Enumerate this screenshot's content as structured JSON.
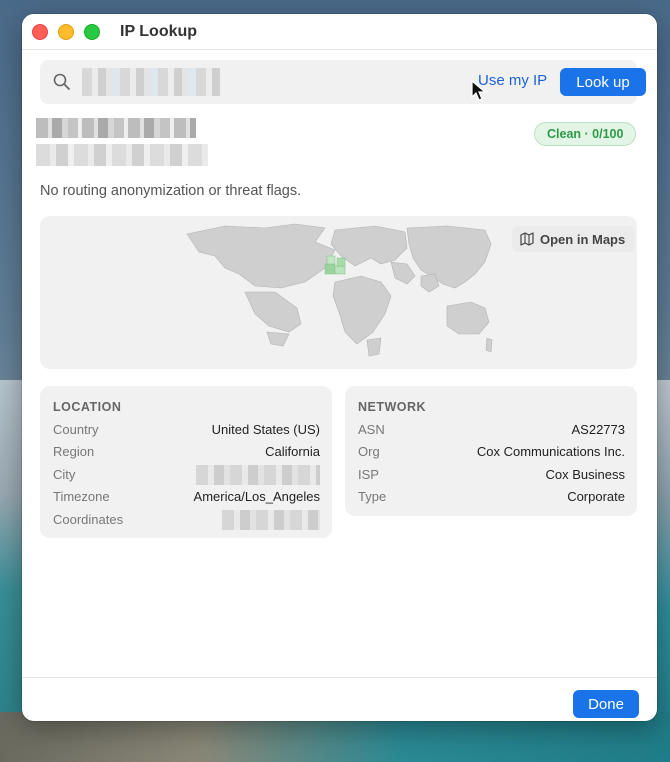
{
  "window": {
    "title": "IP Lookup"
  },
  "search": {
    "use_my_ip_label": "Use my IP",
    "lookup_label": "Look up"
  },
  "result": {
    "badge": "Clean · 0/100",
    "flags_text": "No routing anonymization or threat flags.",
    "open_maps_label": "Open in Maps"
  },
  "location": {
    "heading": "LOCATION",
    "rows": [
      {
        "key": "Country",
        "value": "United States (US)"
      },
      {
        "key": "Region",
        "value": "California"
      },
      {
        "key": "City",
        "value": ""
      },
      {
        "key": "Timezone",
        "value": "America/Los_Angeles"
      },
      {
        "key": "Coordinates",
        "value": ""
      }
    ]
  },
  "network": {
    "heading": "NETWORK",
    "rows": [
      {
        "key": "ASN",
        "value": "AS22773"
      },
      {
        "key": "Org",
        "value": "Cox Communications Inc."
      },
      {
        "key": "ISP",
        "value": "Cox Business"
      },
      {
        "key": "Type",
        "value": "Corporate"
      }
    ]
  },
  "footer": {
    "done_label": "Done"
  },
  "colors": {
    "accent": "#1a73e8",
    "clean_badge_text": "#2e9a48",
    "clean_badge_bg": "#e3f5e6"
  },
  "icons": [
    "search-icon",
    "map-icon",
    "cursor-icon"
  ]
}
